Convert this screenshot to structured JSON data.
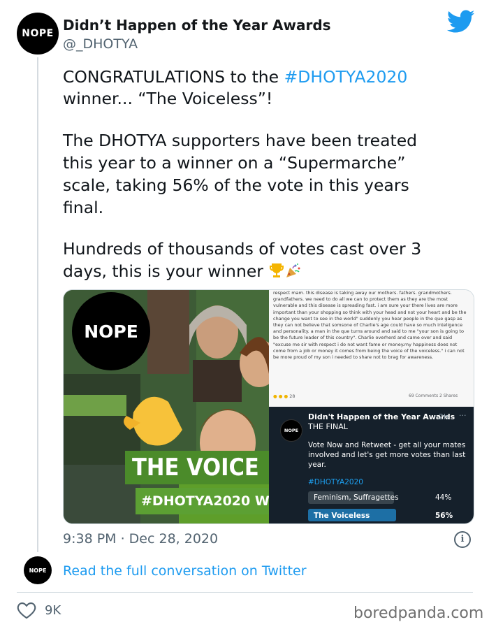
{
  "tweet": {
    "avatar_text": "NOPE",
    "display_name": "Didn’t Happen of the Year Awards",
    "handle": "@_DHOTYA",
    "line1_prefix": "CONGRATULATIONS to the ",
    "hashtag": "#DHOTYA2020",
    "line2": " winner... “The Voiceless”!",
    "para2": [
      "The DHOTYA supporters have been treated",
      "this year to a winner on a “Supermarche”",
      "scale, taking 56% of the vote in this years",
      "final."
    ],
    "para3": [
      "Hundreds of thousands of votes cast over 3",
      "days, this is your winner"
    ],
    "emojis": [
      "trophy-icon",
      "party-popper-icon"
    ],
    "timestamp": "9:38 PM · Dec 28, 2020",
    "read_link": "Read the full conversation on Twitter",
    "likes": "9K"
  },
  "media": {
    "left": {
      "nope_text": "NOPE",
      "banner1": "THE VOICE",
      "banner2": "#DHOTYA2020 W"
    },
    "right_top": {
      "text": "respect mam. this disease is taking away our mothers. fathers. grandmothers. grandfathers. we need to do all we can to protect them as they are the most vulnerable and this disease is spreading fast. i am sure your there lives are more important than your shopping so think with your head and not your heart and be the change you want to see in the world\" suddenly you hear people in the que gasp as they can not believe that somsone of Charlie's age could have so much inteligence and personality. a man in the que turns around and said to me \"your son is going to be the future leader of this country\". Charlie overherd and came over and said \"excuse me sir with respect i do not want fame or money.my happiness does not come from a job or money it comes from being the voice of the voiceless.\" i can not be more proud of my son i needed to share not to brag for awareness.",
      "reactions_count": "28",
      "comments_shares": "69 Comments  2 Shares"
    },
    "right_bottom": {
      "avatar_text": "NOPE",
      "name": "Didn't Happen of the Year Awards",
      "time": "· 2h",
      "title": "THE FINAL",
      "body": "Vote Now and Retweet - get all your mates involved and let's get more votes than last year.",
      "hashtag": "#DHOTYA2020",
      "poll": [
        {
          "label": "Feminism, Suffragettes",
          "pct": "44%",
          "value": 44
        },
        {
          "label": "The Voiceless",
          "pct": "56%",
          "value": 56
        }
      ]
    }
  },
  "watermark": "boredpanda.com",
  "colors": {
    "link": "#1d9bf0",
    "twitter_bird": "#1d9bf0"
  }
}
